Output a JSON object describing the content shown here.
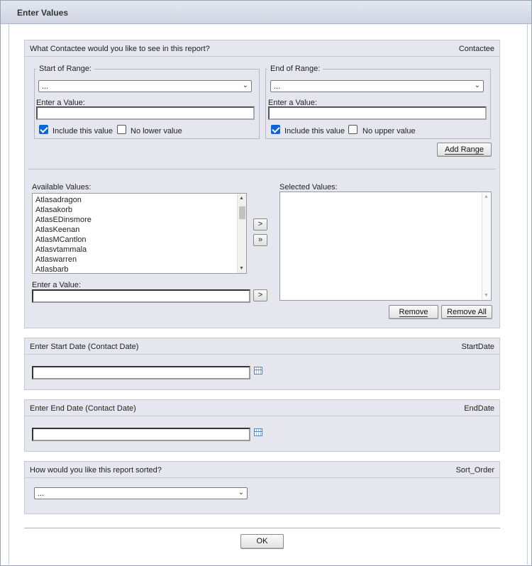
{
  "window": {
    "title": "Enter Values"
  },
  "contactee": {
    "question": "What Contactee would you like to see in this report?",
    "param_name": "Contactee",
    "start": {
      "legend": "Start of Range:",
      "select_value": "...",
      "enter_label": "Enter a Value:",
      "input_value": "",
      "include_label": "Include this value",
      "include_checked": true,
      "bound_label": "No lower value",
      "bound_checked": false
    },
    "end": {
      "legend": "End of Range:",
      "select_value": "...",
      "enter_label": "Enter a Value:",
      "input_value": "",
      "include_label": "Include this value",
      "include_checked": true,
      "bound_label": "No upper value",
      "bound_checked": false
    },
    "add_range_label": "Add Range",
    "available_label": "Available Values:",
    "available_values": [
      "Atlasadragon",
      "Atlasakorb",
      "AtlasEDinsmore",
      "AtlasKeenan",
      "AtlasMCantlon",
      "Atlasvtammala",
      "Atlaswarren",
      "Atlasbarb"
    ],
    "selected_label": "Selected Values:",
    "selected_values": [],
    "move_one_label": ">",
    "move_all_label": "»",
    "enter_label": "Enter a Value:",
    "enter_go_label": ">",
    "remove_label": "Remove",
    "remove_all_label": "Remove All"
  },
  "start_date": {
    "question": "Enter Start Date (Contact Date)",
    "param_name": "StartDate",
    "value": ""
  },
  "end_date": {
    "question": "Enter End Date (Contact Date)",
    "param_name": "EndDate",
    "value": ""
  },
  "sort": {
    "question": "How would you like this report sorted?",
    "param_name": "Sort_Order",
    "select_value": "..."
  },
  "ok_label": "OK",
  "icons": {
    "dropdown": "chevron-down-icon",
    "calendar": "calendar-icon",
    "checkbox_checked": "checkmark-icon"
  }
}
